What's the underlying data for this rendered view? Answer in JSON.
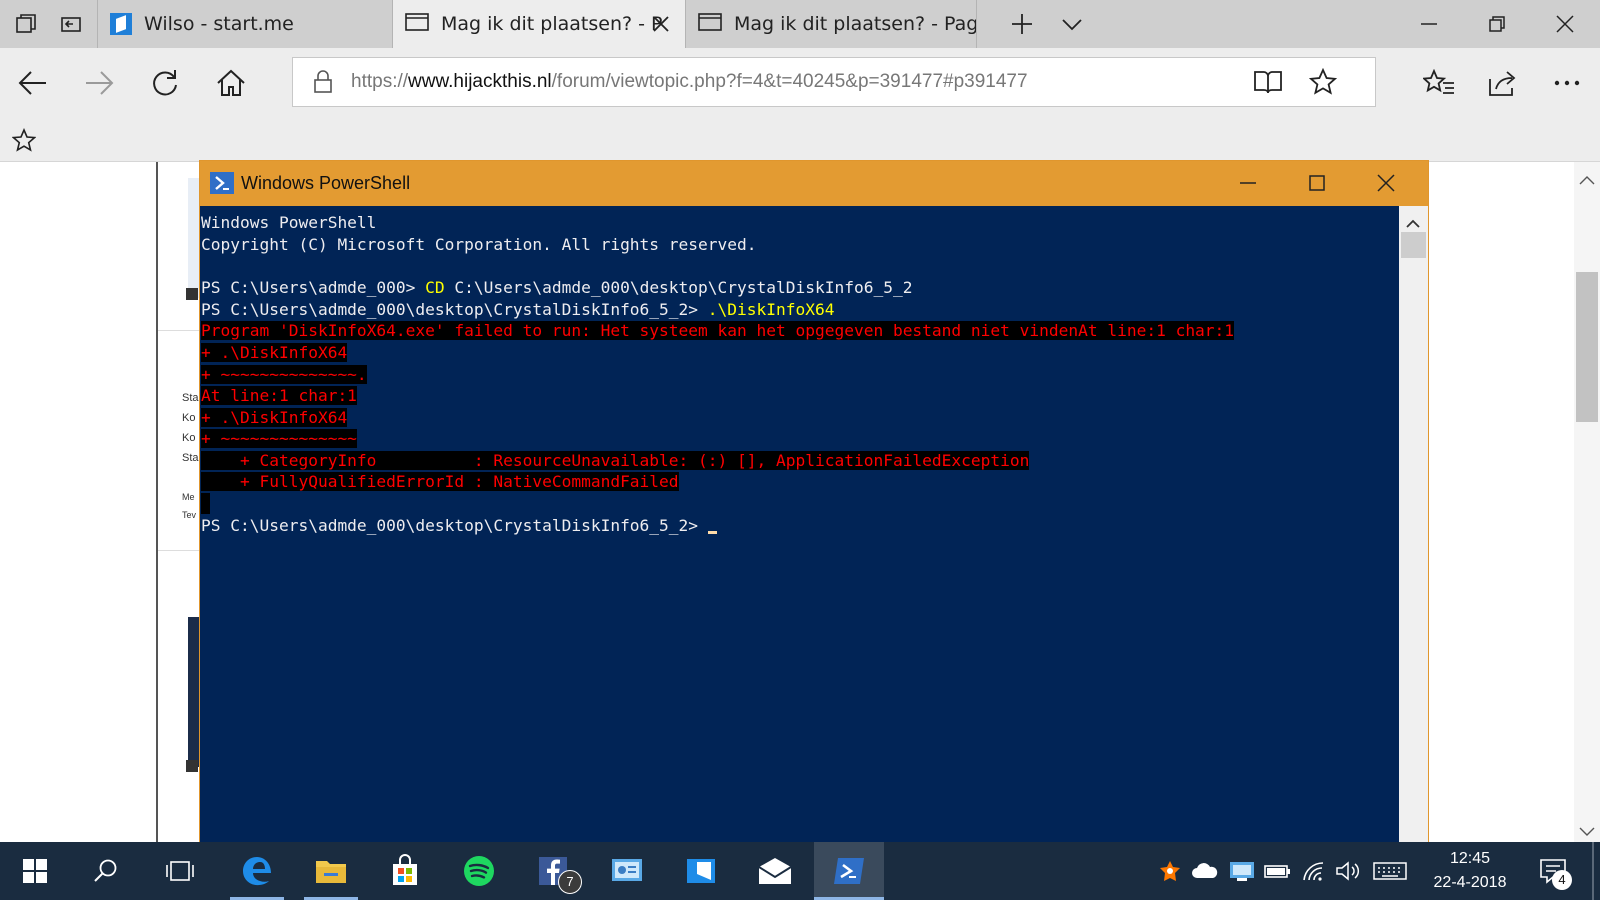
{
  "browser": {
    "tabs": [
      {
        "label": "Wilso - start.me",
        "active": false
      },
      {
        "label": "Mag ik dit plaatsen? - P",
        "active": true
      },
      {
        "label": "Mag ik dit plaatsen? - Pagir",
        "active": false
      }
    ],
    "url": {
      "scheme": "https://",
      "host": "www.hijackthis.nl",
      "path": "/forum/viewtopic.php?f=4&t=40245&p=391477#p391477"
    }
  },
  "page_fragments": [
    "Sta",
    "Ko",
    "Ko",
    "Sta",
    "Me",
    "Tev"
  ],
  "powershell": {
    "title": "Windows PowerShell",
    "lines": {
      "l1": "Windows PowerShell",
      "l2": "Copyright (C) Microsoft Corporation. All rights reserved.",
      "l4_prompt": "PS C:\\Users\\admde_000> ",
      "l4_cmd": "CD",
      "l4_arg": " C:\\Users\\admde_000\\desktop\\CrystalDiskInfo6_5_2",
      "l5_prompt": "PS C:\\Users\\admde_000\\desktop\\CrystalDiskInfo6_5_2> ",
      "l5_cmd": ".\\DiskInfoX64",
      "e1": "Program 'DiskInfoX64.exe' failed to run: Het systeem kan het opgegeven bestand niet vindenAt line:1 char:1",
      "e2": "+ .\\DiskInfoX64",
      "e3": "+ ~~~~~~~~~~~~~~.",
      "e4": "At line:1 char:1",
      "e5": "+ .\\DiskInfoX64",
      "e6": "+ ~~~~~~~~~~~~~~",
      "e7": "    + CategoryInfo          : ResourceUnavailable: (:) [], ApplicationFailedException",
      "e8": "    + FullyQualifiedErrorId : NativeCommandFailed",
      "l_final": "PS C:\\Users\\admde_000\\desktop\\CrystalDiskInfo6_5_2> "
    }
  },
  "taskbar": {
    "facebook_badge": "7",
    "time": "12:45",
    "date": "22-4-2018",
    "notification_count": "4"
  },
  "colors": {
    "ps_background": "#012456",
    "ps_titlebar": "#e39b32",
    "ps_error_fg": "#ff0000",
    "ps_error_bg": "#000000",
    "ps_command": "#ffff00",
    "taskbar": "#1a2c40"
  }
}
